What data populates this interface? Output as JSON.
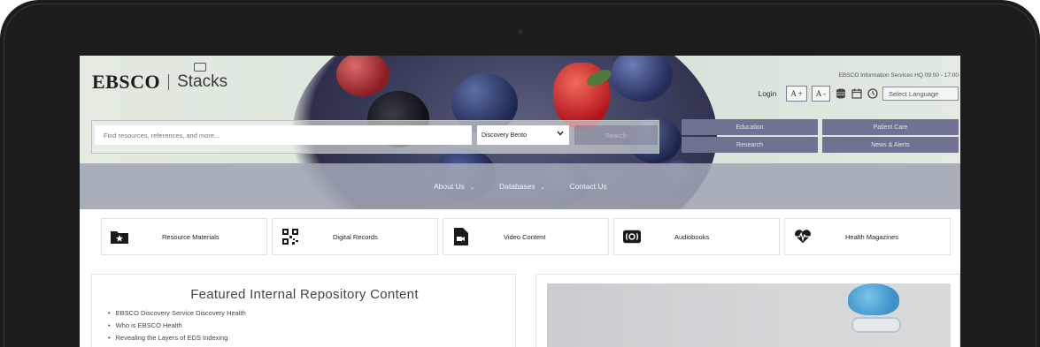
{
  "header": {
    "brand": "EBSCO",
    "product": "Stacks",
    "hq_text": "EBSCO Information Services HQ  09:00 - 17:00",
    "login_label": "Login",
    "font_increase_label": "A +",
    "font_decrease_label": "A -",
    "language_label": "Select Language"
  },
  "search": {
    "placeholder": "Find resources, references, and more...",
    "scope_selected": "Discovery Bento",
    "button_label": "Search"
  },
  "quick_links": [
    {
      "label": "Education"
    },
    {
      "label": "Patient Care"
    },
    {
      "label": "Research"
    },
    {
      "label": "News & Alerts"
    }
  ],
  "nav": [
    {
      "label": "About Us",
      "has_menu": true
    },
    {
      "label": "Databases",
      "has_menu": true
    },
    {
      "label": "Contact Us",
      "has_menu": false
    }
  ],
  "categories": [
    {
      "label": "Resource Materials",
      "icon": "folder-star-icon"
    },
    {
      "label": "Digital Records",
      "icon": "qr-code-icon"
    },
    {
      "label": "Video Content",
      "icon": "video-file-icon"
    },
    {
      "label": "Audiobooks",
      "icon": "audio-icon"
    },
    {
      "label": "Health Magazines",
      "icon": "heartbeat-icon"
    }
  ],
  "featured": {
    "title": "Featured Internal Repository Content",
    "items": [
      "EBSCO Discovery Service Discovery Health",
      "Who is EBSCO Health",
      "Revealing the Layers of EDS Indexing"
    ]
  },
  "colors": {
    "accent": "#6f7290",
    "nav_band": "#a0a6b4",
    "hero_bg": "#dfe8df"
  }
}
